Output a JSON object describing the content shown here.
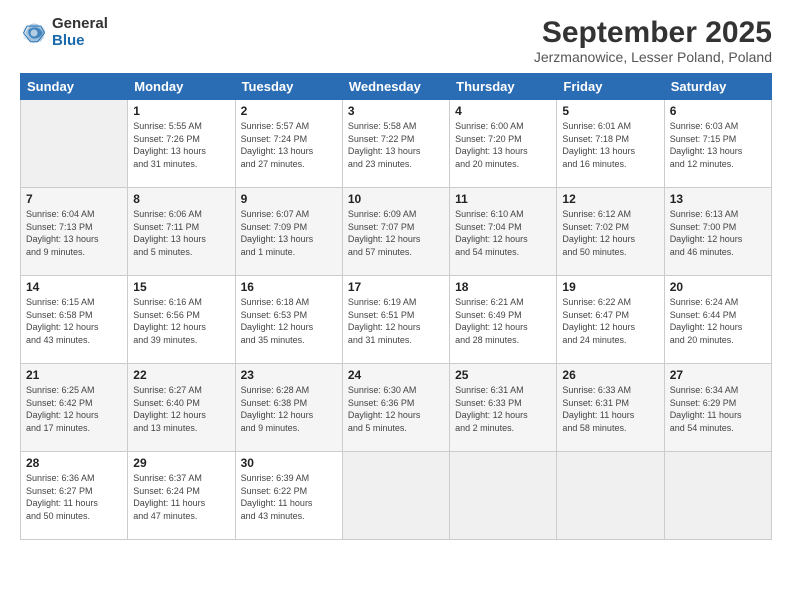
{
  "logo": {
    "general": "General",
    "blue": "Blue"
  },
  "title": "September 2025",
  "location": "Jerzmanowice, Lesser Poland, Poland",
  "headers": [
    "Sunday",
    "Monday",
    "Tuesday",
    "Wednesday",
    "Thursday",
    "Friday",
    "Saturday"
  ],
  "weeks": [
    [
      {
        "day": "",
        "lines": []
      },
      {
        "day": "1",
        "lines": [
          "Sunrise: 5:55 AM",
          "Sunset: 7:26 PM",
          "Daylight: 13 hours",
          "and 31 minutes."
        ]
      },
      {
        "day": "2",
        "lines": [
          "Sunrise: 5:57 AM",
          "Sunset: 7:24 PM",
          "Daylight: 13 hours",
          "and 27 minutes."
        ]
      },
      {
        "day": "3",
        "lines": [
          "Sunrise: 5:58 AM",
          "Sunset: 7:22 PM",
          "Daylight: 13 hours",
          "and 23 minutes."
        ]
      },
      {
        "day": "4",
        "lines": [
          "Sunrise: 6:00 AM",
          "Sunset: 7:20 PM",
          "Daylight: 13 hours",
          "and 20 minutes."
        ]
      },
      {
        "day": "5",
        "lines": [
          "Sunrise: 6:01 AM",
          "Sunset: 7:18 PM",
          "Daylight: 13 hours",
          "and 16 minutes."
        ]
      },
      {
        "day": "6",
        "lines": [
          "Sunrise: 6:03 AM",
          "Sunset: 7:15 PM",
          "Daylight: 13 hours",
          "and 12 minutes."
        ]
      }
    ],
    [
      {
        "day": "7",
        "lines": [
          "Sunrise: 6:04 AM",
          "Sunset: 7:13 PM",
          "Daylight: 13 hours",
          "and 9 minutes."
        ]
      },
      {
        "day": "8",
        "lines": [
          "Sunrise: 6:06 AM",
          "Sunset: 7:11 PM",
          "Daylight: 13 hours",
          "and 5 minutes."
        ]
      },
      {
        "day": "9",
        "lines": [
          "Sunrise: 6:07 AM",
          "Sunset: 7:09 PM",
          "Daylight: 13 hours",
          "and 1 minute."
        ]
      },
      {
        "day": "10",
        "lines": [
          "Sunrise: 6:09 AM",
          "Sunset: 7:07 PM",
          "Daylight: 12 hours",
          "and 57 minutes."
        ]
      },
      {
        "day": "11",
        "lines": [
          "Sunrise: 6:10 AM",
          "Sunset: 7:04 PM",
          "Daylight: 12 hours",
          "and 54 minutes."
        ]
      },
      {
        "day": "12",
        "lines": [
          "Sunrise: 6:12 AM",
          "Sunset: 7:02 PM",
          "Daylight: 12 hours",
          "and 50 minutes."
        ]
      },
      {
        "day": "13",
        "lines": [
          "Sunrise: 6:13 AM",
          "Sunset: 7:00 PM",
          "Daylight: 12 hours",
          "and 46 minutes."
        ]
      }
    ],
    [
      {
        "day": "14",
        "lines": [
          "Sunrise: 6:15 AM",
          "Sunset: 6:58 PM",
          "Daylight: 12 hours",
          "and 43 minutes."
        ]
      },
      {
        "day": "15",
        "lines": [
          "Sunrise: 6:16 AM",
          "Sunset: 6:56 PM",
          "Daylight: 12 hours",
          "and 39 minutes."
        ]
      },
      {
        "day": "16",
        "lines": [
          "Sunrise: 6:18 AM",
          "Sunset: 6:53 PM",
          "Daylight: 12 hours",
          "and 35 minutes."
        ]
      },
      {
        "day": "17",
        "lines": [
          "Sunrise: 6:19 AM",
          "Sunset: 6:51 PM",
          "Daylight: 12 hours",
          "and 31 minutes."
        ]
      },
      {
        "day": "18",
        "lines": [
          "Sunrise: 6:21 AM",
          "Sunset: 6:49 PM",
          "Daylight: 12 hours",
          "and 28 minutes."
        ]
      },
      {
        "day": "19",
        "lines": [
          "Sunrise: 6:22 AM",
          "Sunset: 6:47 PM",
          "Daylight: 12 hours",
          "and 24 minutes."
        ]
      },
      {
        "day": "20",
        "lines": [
          "Sunrise: 6:24 AM",
          "Sunset: 6:44 PM",
          "Daylight: 12 hours",
          "and 20 minutes."
        ]
      }
    ],
    [
      {
        "day": "21",
        "lines": [
          "Sunrise: 6:25 AM",
          "Sunset: 6:42 PM",
          "Daylight: 12 hours",
          "and 17 minutes."
        ]
      },
      {
        "day": "22",
        "lines": [
          "Sunrise: 6:27 AM",
          "Sunset: 6:40 PM",
          "Daylight: 12 hours",
          "and 13 minutes."
        ]
      },
      {
        "day": "23",
        "lines": [
          "Sunrise: 6:28 AM",
          "Sunset: 6:38 PM",
          "Daylight: 12 hours",
          "and 9 minutes."
        ]
      },
      {
        "day": "24",
        "lines": [
          "Sunrise: 6:30 AM",
          "Sunset: 6:36 PM",
          "Daylight: 12 hours",
          "and 5 minutes."
        ]
      },
      {
        "day": "25",
        "lines": [
          "Sunrise: 6:31 AM",
          "Sunset: 6:33 PM",
          "Daylight: 12 hours",
          "and 2 minutes."
        ]
      },
      {
        "day": "26",
        "lines": [
          "Sunrise: 6:33 AM",
          "Sunset: 6:31 PM",
          "Daylight: 11 hours",
          "and 58 minutes."
        ]
      },
      {
        "day": "27",
        "lines": [
          "Sunrise: 6:34 AM",
          "Sunset: 6:29 PM",
          "Daylight: 11 hours",
          "and 54 minutes."
        ]
      }
    ],
    [
      {
        "day": "28",
        "lines": [
          "Sunrise: 6:36 AM",
          "Sunset: 6:27 PM",
          "Daylight: 11 hours",
          "and 50 minutes."
        ]
      },
      {
        "day": "29",
        "lines": [
          "Sunrise: 6:37 AM",
          "Sunset: 6:24 PM",
          "Daylight: 11 hours",
          "and 47 minutes."
        ]
      },
      {
        "day": "30",
        "lines": [
          "Sunrise: 6:39 AM",
          "Sunset: 6:22 PM",
          "Daylight: 11 hours",
          "and 43 minutes."
        ]
      },
      {
        "day": "",
        "lines": []
      },
      {
        "day": "",
        "lines": []
      },
      {
        "day": "",
        "lines": []
      },
      {
        "day": "",
        "lines": []
      }
    ]
  ]
}
